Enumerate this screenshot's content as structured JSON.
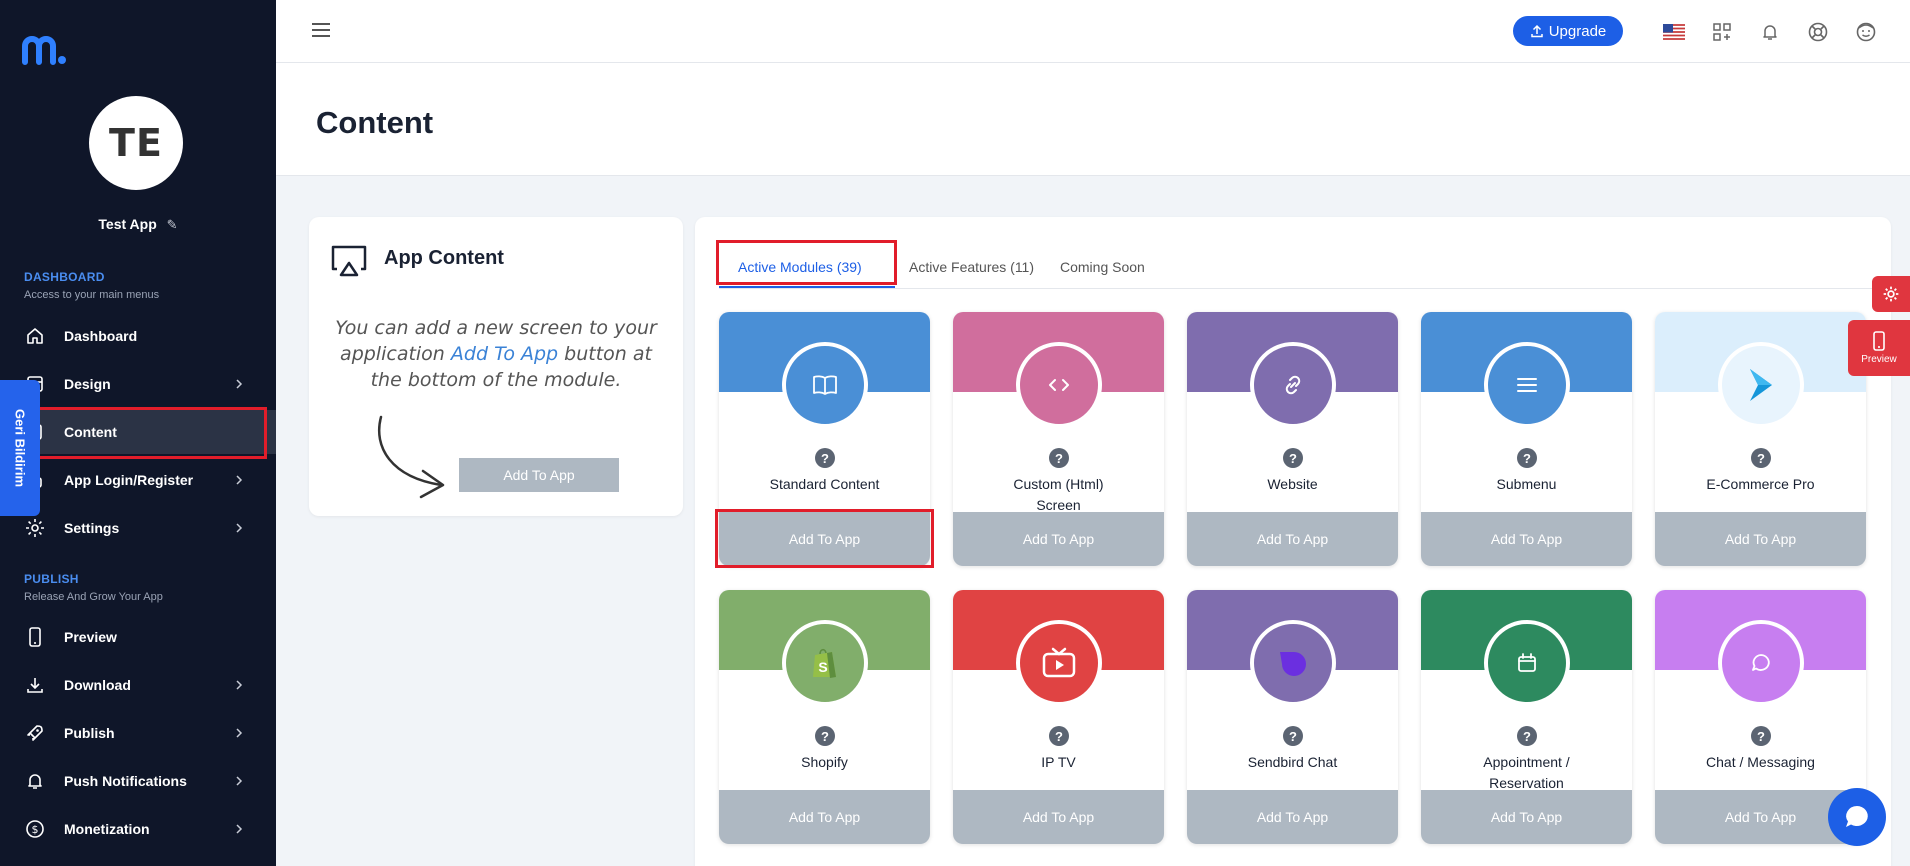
{
  "sidebar": {
    "avatar_initials": "TE",
    "app_name": "Test App",
    "dashboard_section": {
      "title": "DASHBOARD",
      "subtitle": "Access to your main menus"
    },
    "publish_section": {
      "title": "PUBLISH",
      "subtitle": "Release And Grow Your App"
    },
    "items": [
      {
        "label": "Dashboard"
      },
      {
        "label": "Design"
      },
      {
        "label": "Content"
      },
      {
        "label": "App Login/Register"
      },
      {
        "label": "Settings"
      },
      {
        "label": "Preview"
      },
      {
        "label": "Download"
      },
      {
        "label": "Publish"
      },
      {
        "label": "Push Notifications"
      },
      {
        "label": "Monetization"
      }
    ],
    "feedback_label": "Geri Bildirim"
  },
  "header": {
    "upgrade_label": "Upgrade"
  },
  "page": {
    "title": "Content"
  },
  "app_content_card": {
    "title": "App Content",
    "hint_before": "You can add a new screen to your application ",
    "hint_highlight": "Add To App",
    "hint_after": " button at the bottom of the module.",
    "demo_button": "Add To App"
  },
  "tabs": {
    "active_modules": "Active Modules (39)",
    "active_features": "Active Features (11)",
    "coming_soon": "Coming Soon"
  },
  "modules": [
    {
      "name": "Standard Content",
      "band_color": "#4a8fd6",
      "circle_color": "#4a8fd6",
      "icon": "book-icon",
      "button": "Add To App"
    },
    {
      "name": "Custom (Html) Screen",
      "band_color": "#d06e9d",
      "circle_color": "#d06e9d",
      "icon": "code-icon",
      "button": "Add To App"
    },
    {
      "name": "Website",
      "band_color": "#7f6dae",
      "circle_color": "#7f6dae",
      "icon": "link-icon",
      "button": "Add To App"
    },
    {
      "name": "Submenu",
      "band_color": "#4a8fd6",
      "circle_color": "#4a8fd6",
      "icon": "list-icon",
      "button": "Add To App"
    },
    {
      "name": "E-Commerce Pro",
      "band_color": "#dbeefc",
      "circle_color": "#e8f4fd",
      "icon": "ecommerce-logo-icon",
      "button": "Add To App"
    },
    {
      "name": "Shopify",
      "band_color": "#81ae6b",
      "circle_color": "#81ae6b",
      "icon": "shopify-bag-icon",
      "button": "Add To App"
    },
    {
      "name": "IP TV",
      "band_color": "#e04343",
      "circle_color": "#e04343",
      "icon": "tv-icon",
      "button": "Add To App"
    },
    {
      "name": "Sendbird Chat",
      "band_color": "#7f6dae",
      "circle_color": "#7f6dae",
      "icon": "sendbird-icon",
      "button": "Add To App"
    },
    {
      "name": "Appointment / Reservation",
      "band_color": "#2d8a5f",
      "circle_color": "#2d8a5f",
      "icon": "calendar-icon",
      "button": "Add To App"
    },
    {
      "name": "Chat / Messaging",
      "band_color": "#c77ef0",
      "circle_color": "#c77ef0",
      "icon": "chat-icon",
      "button": "Add To App"
    }
  ],
  "floating": {
    "preview_label": "Preview"
  }
}
